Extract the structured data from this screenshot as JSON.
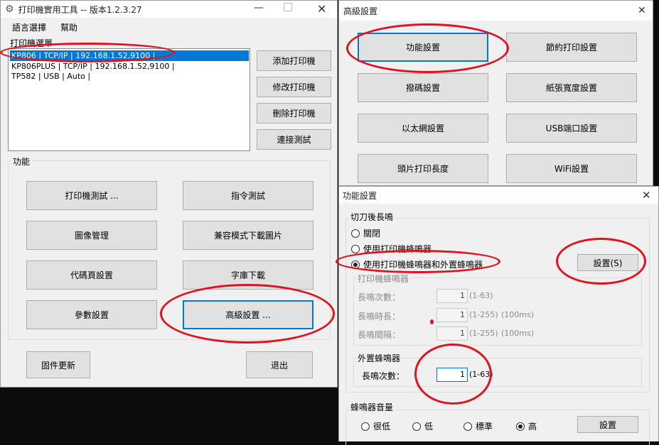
{
  "main": {
    "title": "打印機實用工具 -- 版本1.2.3.27",
    "menu": [
      "語言選擇",
      "幫助"
    ],
    "printer_list_label": "打印機選單",
    "printers": [
      "KP806 | TCP/IP | 192.168.1.52,9100 |",
      "KP806PLUS | TCP/IP | 192.168.1.52,9100 |",
      "TP582 | USB | Auto |"
    ],
    "side_buttons": [
      "添加打印機",
      "修改打印機",
      "刪除打印機",
      "連接測試"
    ],
    "function_label": "功能",
    "function_buttons": [
      "打印機測試 ...",
      "指令測試",
      "圖像管理",
      "兼容模式下載圖片",
      "代碼頁設置",
      "字庫下載",
      "參數設置",
      "高級設置 ..."
    ],
    "firmware_button": "固件更新",
    "exit_button": "退出"
  },
  "advanced": {
    "title": "高級設置",
    "buttons": [
      "功能設置",
      "節約打印設置",
      "撥碼設置",
      "紙張寬度設置",
      "以太網設置",
      "USB端口設置",
      "頭片打印長度",
      "WiFi設置"
    ]
  },
  "function": {
    "title": "功能設置",
    "cutter_label": "切刀後長鳴",
    "options": [
      "關閉",
      "使用打印機蜂鳴器",
      "使用打印機蜂鳴器和外置蜂鳴器"
    ],
    "selected_option": 2,
    "set_button": "設置(S)",
    "printer_buzzer_label": "打印機蜂鳴器",
    "rows": [
      {
        "label": "長鳴次數：",
        "value": "1",
        "range": "(1-63)",
        "unit": ""
      },
      {
        "label": "長鳴時長：",
        "value": "1",
        "range": "(1-255)",
        "unit": "(100ms)"
      },
      {
        "label": "長鳴間隔：",
        "value": "1",
        "range": "(1-255)",
        "unit": "(100ms)"
      }
    ],
    "external_label": "外置蜂鳴器",
    "external_row": {
      "label": "長鳴次數：",
      "value": "1",
      "range": "(1-63)"
    },
    "volume_label": "蜂鳴器音量",
    "volumes": [
      "很低",
      "低",
      "標準",
      "高"
    ],
    "selected_volume": 3,
    "volume_set_button": "設置"
  },
  "colors": {
    "annotation": "#e0141e",
    "selection": "#0078d7"
  }
}
